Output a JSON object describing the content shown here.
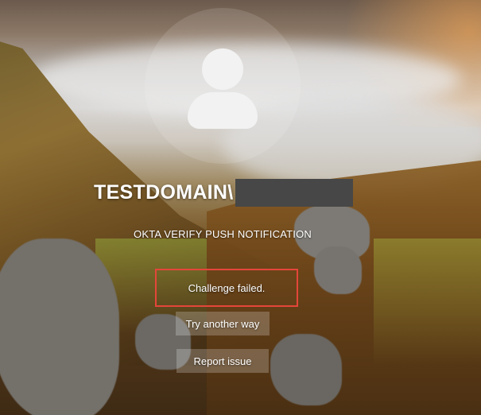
{
  "user": {
    "domain_prefix": "TESTDOMAIN\\"
  },
  "auth": {
    "provider_text": "OKTA VERIFY PUSH NOTIFICATION",
    "status_text": "Challenge failed."
  },
  "actions": {
    "try_another_label": "Try another way",
    "report_issue_label": "Report issue"
  },
  "colors": {
    "status_border": "#e4463a",
    "redaction": "#474747"
  },
  "icons": {
    "avatar": "user-silhouette-icon"
  }
}
